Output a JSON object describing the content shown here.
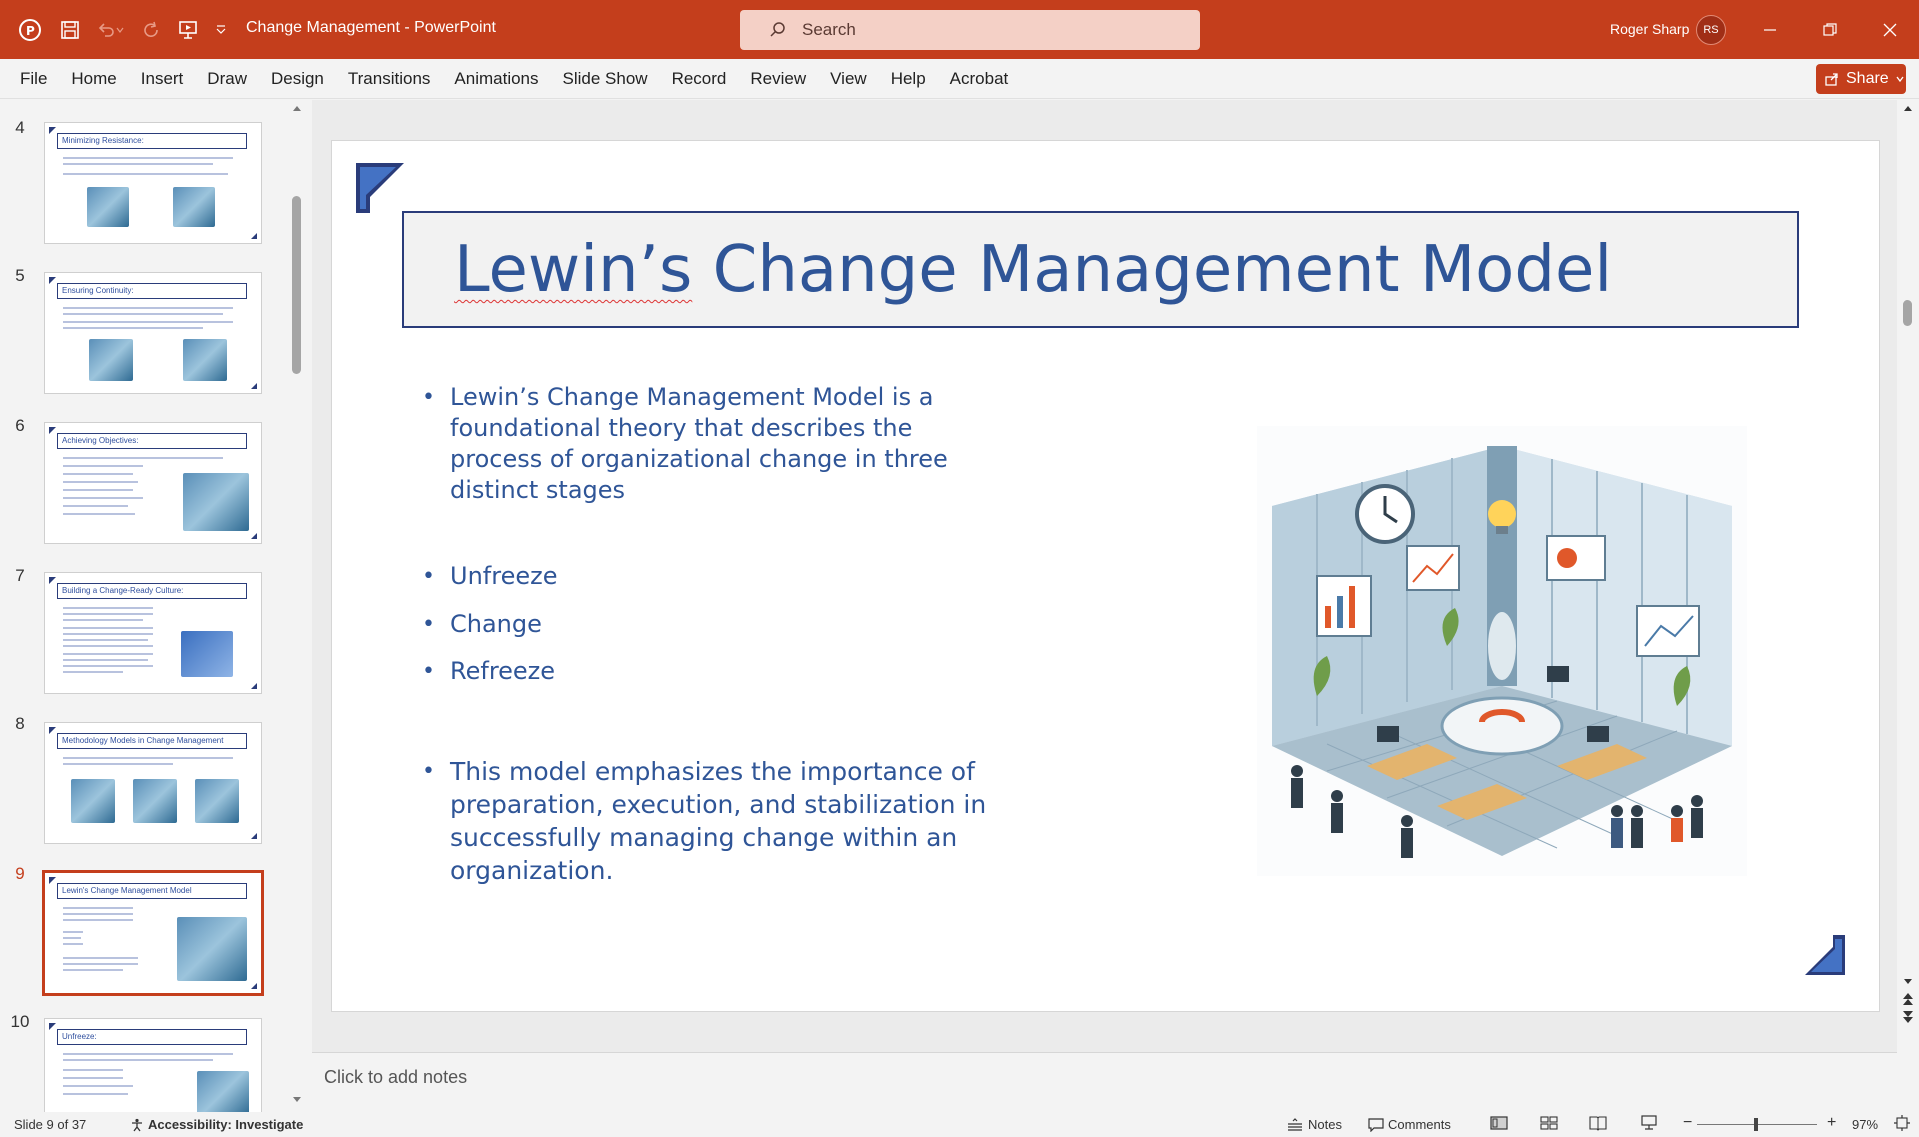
{
  "titlebar": {
    "document_title": "Change Management  -  PowerPoint",
    "search_placeholder": "Search",
    "user_name": "Roger Sharp",
    "user_initials": "RS",
    "accent_color": "#c43e1c"
  },
  "menubar": {
    "items": [
      "File",
      "Home",
      "Insert",
      "Draw",
      "Design",
      "Transitions",
      "Animations",
      "Slide Show",
      "Record",
      "Review",
      "View",
      "Help",
      "Acrobat"
    ],
    "share_label": "Share"
  },
  "thumbnails": [
    {
      "number": "4",
      "title": "Minimizing Resistance:"
    },
    {
      "number": "5",
      "title": "Ensuring Continuity:"
    },
    {
      "number": "6",
      "title": "Achieving Objectives:"
    },
    {
      "number": "7",
      "title": "Building a Change-Ready Culture:"
    },
    {
      "number": "8",
      "title": "Methodology Models in Change Management"
    },
    {
      "number": "9",
      "title": "Lewin's Change Management Model"
    },
    {
      "number": "10",
      "title": "Unfreeze:"
    }
  ],
  "slide": {
    "title_word1": "Lewin’s",
    "title_rest": " Change Management Model",
    "bullet_intro": "Lewin’s Change Management Model is a foundational theory that describes the process of organizational change in three distinct stages",
    "stages": [
      "Unfreeze",
      "Change",
      "Refreeze"
    ],
    "bullet_closing": "This model emphasizes the importance of preparation, execution, and stabilization in successfully managing change within an organization.",
    "title_color": "#2f5597"
  },
  "notes_placeholder": "Click to add notes",
  "statusbar": {
    "slide_indicator": "Slide 9 of 37",
    "accessibility": "Accessibility: Investigate",
    "notes_label": "Notes",
    "comments_label": "Comments",
    "zoom_level": "97%"
  }
}
